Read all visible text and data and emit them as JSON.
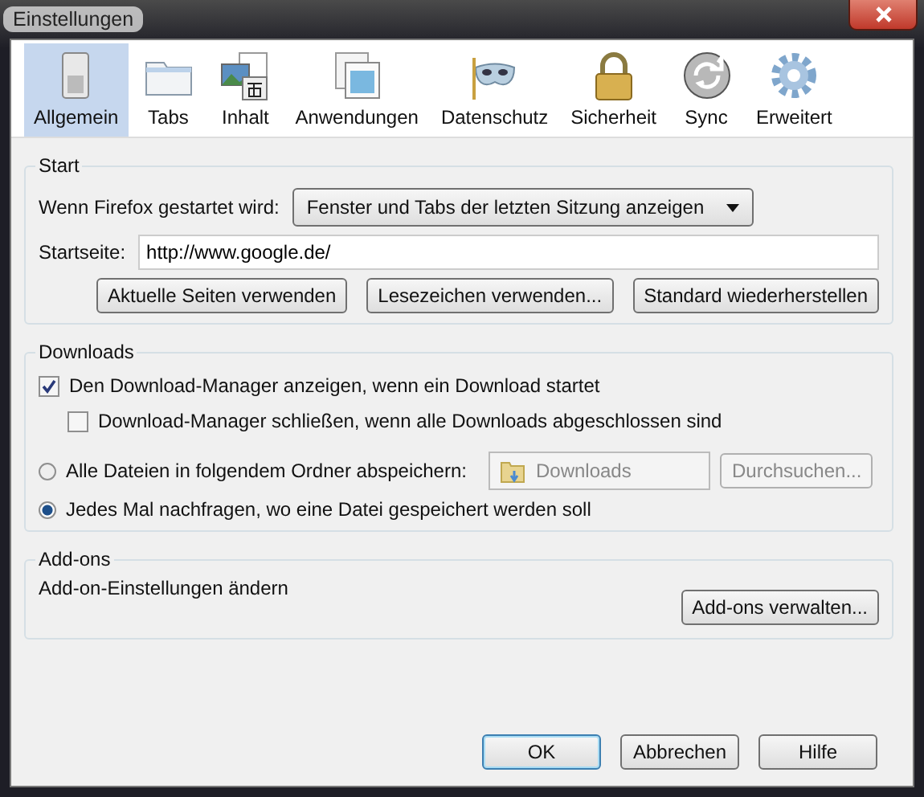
{
  "window": {
    "title": "Einstellungen"
  },
  "tabs": [
    {
      "label": "Allgemein",
      "selected": true
    },
    {
      "label": "Tabs",
      "selected": false
    },
    {
      "label": "Inhalt",
      "selected": false
    },
    {
      "label": "Anwendungen",
      "selected": false
    },
    {
      "label": "Datenschutz",
      "selected": false
    },
    {
      "label": "Sicherheit",
      "selected": false
    },
    {
      "label": "Sync",
      "selected": false
    },
    {
      "label": "Erweitert",
      "selected": false
    }
  ],
  "start": {
    "heading": "Start",
    "startup_label": "Wenn Firefox gestartet wird:",
    "startup_choice": "Fenster und Tabs der letzten Sitzung anzeigen",
    "homepage_label": "Startseite:",
    "homepage": "http://www.google.de/",
    "buttons": [
      "Aktuelle Seiten verwenden",
      "Lesezeichen verwenden...",
      "Standard wiederherstellen"
    ]
  },
  "downloads": {
    "heading": "Downloads",
    "options": [
      {
        "kind": "checkbox",
        "label": "Den Download-Manager anzeigen, wenn ein Download startet",
        "checked": true,
        "children": [
          {
            "label": "Download-Manager schließen, wenn alle Downloads abgeschlossen sind",
            "checked": false
          }
        ]
      },
      {
        "kind": "radio",
        "label": "Alle Dateien in folgendem Ordner abspeichern:",
        "selected": false,
        "folder": "Downloads",
        "browse": "Durchsuchen..."
      },
      {
        "kind": "radio",
        "label": "Jedes Mal nachfragen, wo eine Datei gespeichert werden soll",
        "selected": true
      }
    ]
  },
  "addons": {
    "heading": "Add-ons",
    "text": "Add-on-Einstellungen ändern",
    "button": "Add-ons verwalten..."
  },
  "dialog_buttons": [
    {
      "label": "OK",
      "default": true
    },
    {
      "label": "Abbrechen",
      "default": false
    },
    {
      "label": "Hilfe",
      "default": false
    }
  ]
}
